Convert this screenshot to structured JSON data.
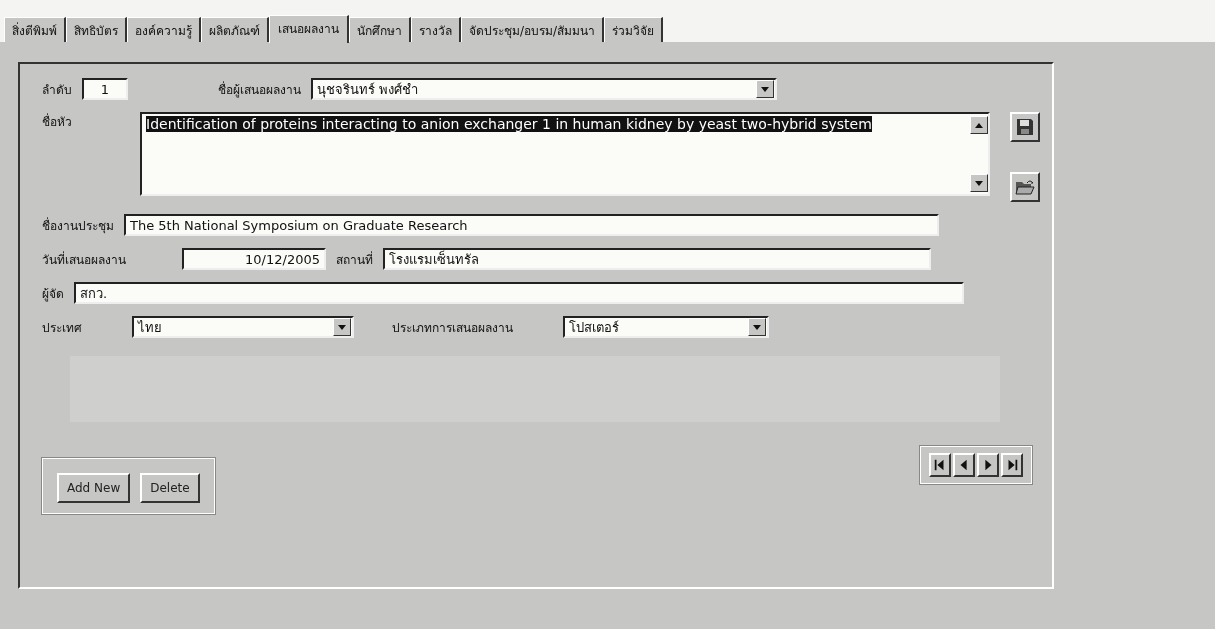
{
  "tabs": [
    {
      "label": "สิ่งตีพิมพ์",
      "selected": false
    },
    {
      "label": "สิทธิบัตร",
      "selected": false
    },
    {
      "label": "องค์ความรู้",
      "selected": false
    },
    {
      "label": "ผลิตภัณฑ์",
      "selected": false
    },
    {
      "label": "เสนอผลงาน",
      "selected": true
    },
    {
      "label": "นักศึกษา",
      "selected": false
    },
    {
      "label": "รางวัล",
      "selected": false
    },
    {
      "label": "จัดประชุม/อบรม/สัมมนา",
      "selected": false
    },
    {
      "label": "ร่วมวิจัย",
      "selected": false
    }
  ],
  "form": {
    "order": {
      "label": "ลำดับ",
      "value": "1"
    },
    "presenter": {
      "label": "ชื่อผู้เสนอผลงาน",
      "value": "นุชจรินทร์  พงศ์ชำ"
    },
    "title": {
      "label": "ชื่อหัว",
      "value": "Identification of proteins interacting to anion exchanger 1 in human kidney by yeast two-hybrid system",
      "text_selected": true
    },
    "conference": {
      "label": "ชื่องานประชุม",
      "value": "The 5th National Symposium on Graduate Research"
    },
    "date": {
      "label": "วันที่เสนอผลงาน",
      "value": "10/12/2005"
    },
    "venue": {
      "label": "สถานที่",
      "value": "โรงแรมเซ็นทรัล"
    },
    "organizer": {
      "label": "ผู้จัด",
      "value": "สกว."
    },
    "country": {
      "label": "ประเทศ",
      "value": "ไทย"
    },
    "presentation_type": {
      "label": "ประเภทการเสนอผลงาน",
      "value": "โปสเตอร์"
    }
  },
  "buttons": [
    "Add New",
    "Delete"
  ]
}
